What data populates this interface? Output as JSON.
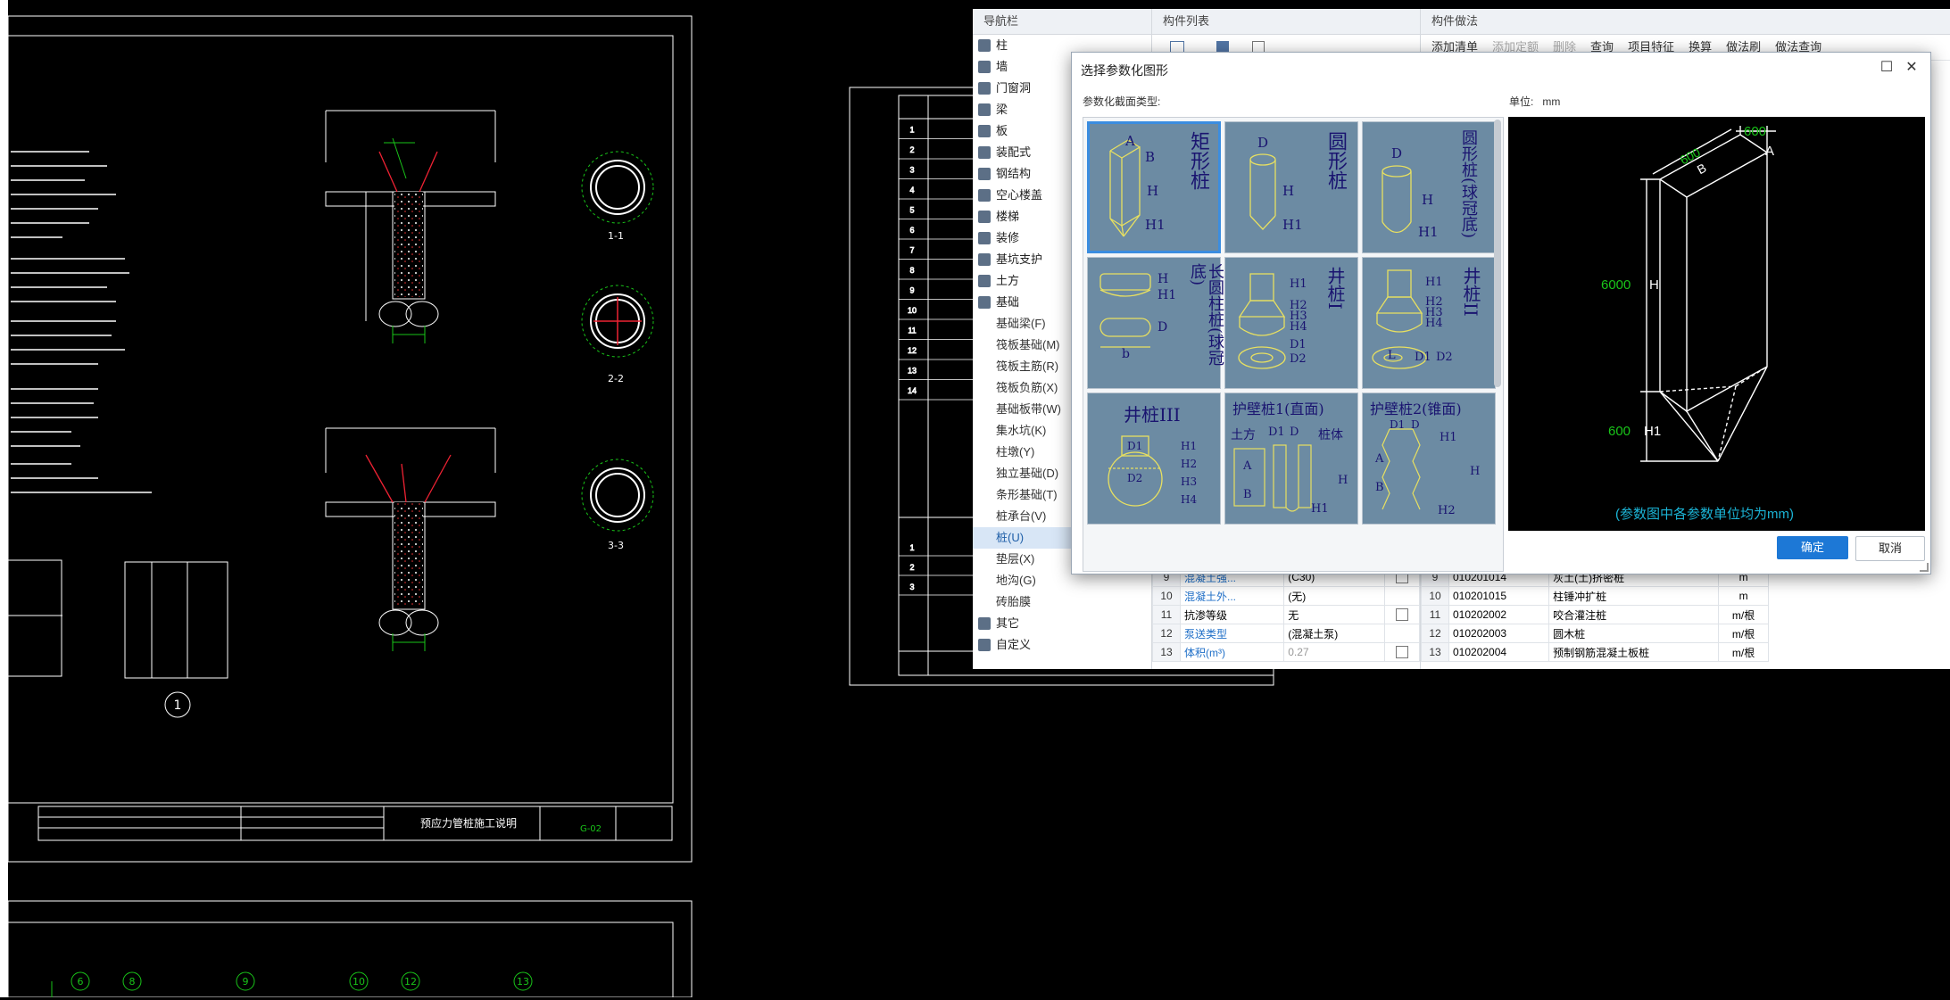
{
  "cad": {
    "axis_bubbles": [
      "6",
      "8",
      "9",
      "10",
      "12",
      "13"
    ],
    "detail_bubble": "1",
    "section_labels": [
      "1-1",
      "2-2",
      "3-3"
    ],
    "title_block_name": "预应力管桩施工说明",
    "title_block_no": "G-02",
    "right_table_rows": [
      "1",
      "2",
      "3",
      "4",
      "5",
      "6",
      "7",
      "8",
      "9",
      "10",
      "11",
      "12",
      "13",
      "14"
    ],
    "right_table_rows2": [
      "1",
      "2",
      "3"
    ]
  },
  "nav": {
    "header": "导航栏",
    "items": [
      {
        "label": "柱",
        "icon": "column-icon"
      },
      {
        "label": "墙",
        "icon": "wall-icon"
      },
      {
        "label": "门窗洞",
        "icon": "door-window-icon"
      },
      {
        "label": "梁",
        "icon": "beam-icon"
      },
      {
        "label": "板",
        "icon": "slab-icon"
      },
      {
        "label": "装配式",
        "icon": "prefab-icon"
      },
      {
        "label": "钢结构",
        "icon": "steel-icon"
      },
      {
        "label": "空心楼盖",
        "icon": "hollow-floor-icon"
      },
      {
        "label": "楼梯",
        "icon": "stair-icon"
      },
      {
        "label": "装修",
        "icon": "decoration-icon"
      },
      {
        "label": "基坑支护",
        "icon": "pit-support-icon"
      },
      {
        "label": "土方",
        "icon": "earthwork-icon"
      },
      {
        "label": "基础",
        "icon": "foundation-icon"
      }
    ],
    "sub_items": [
      "基础梁(F)",
      "筏板基础(M)",
      "筏板主筋(R)",
      "筏板负筋(X)",
      "基础板带(W)",
      "集水坑(K)",
      "柱墩(Y)",
      "独立基础(D)",
      "条形基础(T)",
      "桩承台(V)",
      "桩(U)",
      "垫层(X)",
      "地沟(G)",
      "砖胎膜"
    ],
    "selected_sub": "桩(U)",
    "tail_items": [
      {
        "label": "其它",
        "icon": "other-icon"
      },
      {
        "label": "自定义",
        "icon": "custom-icon"
      }
    ]
  },
  "complist": {
    "header": "构件列表",
    "rows": [
      {
        "n": "9",
        "name": "混凝土强...",
        "value": "(C30)",
        "chk": true
      },
      {
        "n": "10",
        "name": "混凝土外...",
        "value": "(无)",
        "chk": false
      },
      {
        "n": "11",
        "name": "抗渗等级",
        "value": "无",
        "chk": true
      },
      {
        "n": "12",
        "name": "泵送类型",
        "value": "(混凝土泵)",
        "chk": false
      },
      {
        "n": "13",
        "name": "体积(m³)",
        "value": "0.27",
        "chk": true
      }
    ]
  },
  "method": {
    "header": "构件做法",
    "toolbar": [
      "添加清单",
      "添加定额",
      "删除",
      "查询",
      "项目特征",
      "换算",
      "做法刷",
      "做法查询"
    ],
    "rows": [
      {
        "n": "9",
        "code": "010201014",
        "name": "灰土(土)挤密桩",
        "unit": "m"
      },
      {
        "n": "10",
        "code": "010201015",
        "name": "柱锤冲扩桩",
        "unit": "m"
      },
      {
        "n": "11",
        "code": "010202002",
        "name": "咬合灌注桩",
        "unit": "m/根"
      },
      {
        "n": "12",
        "code": "010202003",
        "name": "圆木桩",
        "unit": "m/根"
      },
      {
        "n": "13",
        "code": "010202004",
        "name": "预制钢筋混凝土板桩",
        "unit": "m/根"
      }
    ]
  },
  "dialog": {
    "title": "选择参数化图形",
    "shape_type_label": "参数化截面类型:",
    "unit_label": "单位:",
    "unit_value": "mm",
    "tiles": [
      {
        "name": "矩形桩",
        "selected": true
      },
      {
        "name": "圆形桩"
      },
      {
        "name": "圆形桩(球冠底)"
      },
      {
        "name": "长圆柱桩(球冠底)"
      },
      {
        "name": "井桩I"
      },
      {
        "name": "井桩II"
      },
      {
        "name": "井桩III"
      },
      {
        "name": "护壁桩1(直面)"
      },
      {
        "name": "护壁桩2(锥面)"
      }
    ],
    "tile_letters": {
      "A": "A",
      "B": "B",
      "D": "D",
      "H": "H",
      "H1": "H1",
      "H2": "H2",
      "H3": "H3",
      "H4": "H4",
      "D1": "D1",
      "D2": "D2",
      "b": "b",
      "L": "L",
      "earth": "土方",
      "body": "桩体"
    },
    "preview": {
      "dim_A": "600",
      "dim_B": "600",
      "label_A": "A",
      "label_B": "B",
      "dim_H": "6000",
      "label_H": "H",
      "dim_H1": "600",
      "label_H1": "H1",
      "note": "(参数图中各参数单位均为mm)"
    },
    "ok_label": "确定",
    "cancel_label": "取消",
    "colors": {
      "primary": "#1d78d6",
      "dim_green": "#19c419",
      "note_cyan": "#1bb4d6"
    }
  }
}
